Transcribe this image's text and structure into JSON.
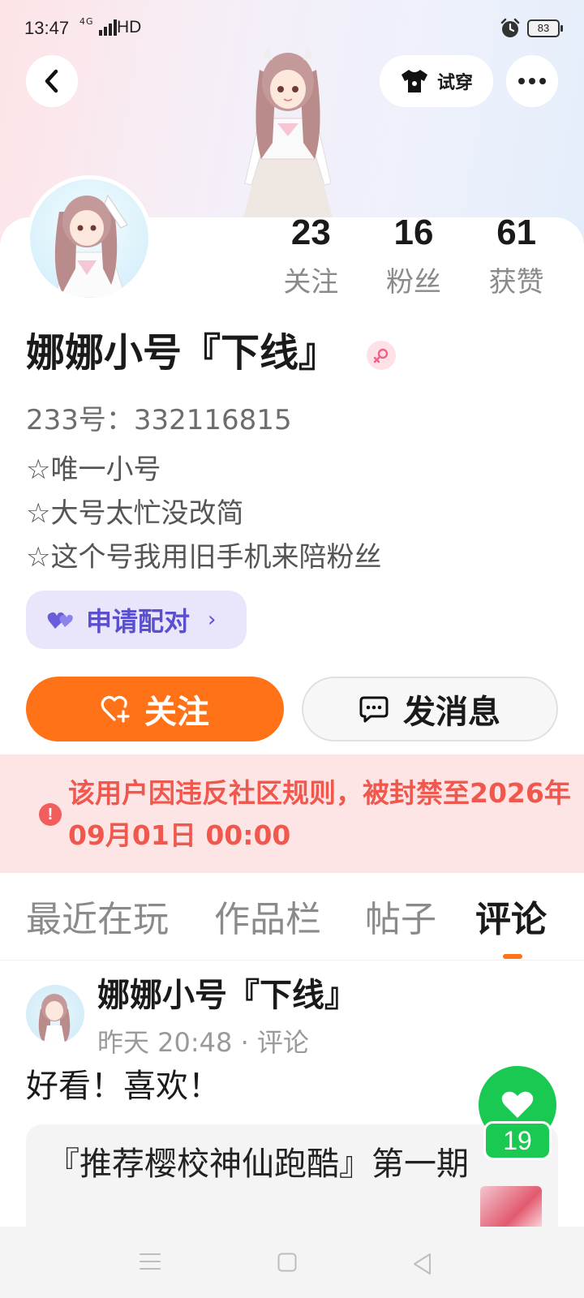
{
  "status_bar": {
    "time": "13:47",
    "network": "4G",
    "hd": "HD",
    "battery": "83"
  },
  "header": {
    "back_icon": "chevron-left-icon",
    "tryon_label": "试穿",
    "more_icon": "more-dots-icon"
  },
  "profile": {
    "stats": [
      {
        "value": "23",
        "label": "关注"
      },
      {
        "value": "16",
        "label": "粉丝"
      },
      {
        "value": "61",
        "label": "获赞"
      }
    ],
    "name": "娜娜小号『下线』",
    "gender_icon": "female-icon",
    "uid": "233号：332116815",
    "bio": [
      "☆唯一小号",
      "☆大号太忙没改简",
      "☆这个号我用旧手机来陪粉丝"
    ],
    "pair_label": "申请配对",
    "pair_chevron": "›",
    "follow_label": "关注",
    "message_label": "发消息"
  },
  "ban_notice": {
    "icon": "!",
    "text": "该用户因违反社区规则，被封禁至2026年09月01日 00:00"
  },
  "tabs": [
    {
      "label": "最近在玩",
      "active": false
    },
    {
      "label": "作品栏",
      "active": false
    },
    {
      "label": "帖子",
      "active": false
    },
    {
      "label": "评论",
      "active": true
    }
  ],
  "post": {
    "author": "娜娜小号『下线』",
    "meta": "昨天 20:48 · 评论",
    "text": "好看！喜欢！",
    "quote": "『推荐樱校神仙跑酷』第一期",
    "like_count": "19"
  },
  "colors": {
    "accent": "#ff7217",
    "ban_text": "#f0584e",
    "pair": "#5a4fcf",
    "like": "#19c952"
  }
}
